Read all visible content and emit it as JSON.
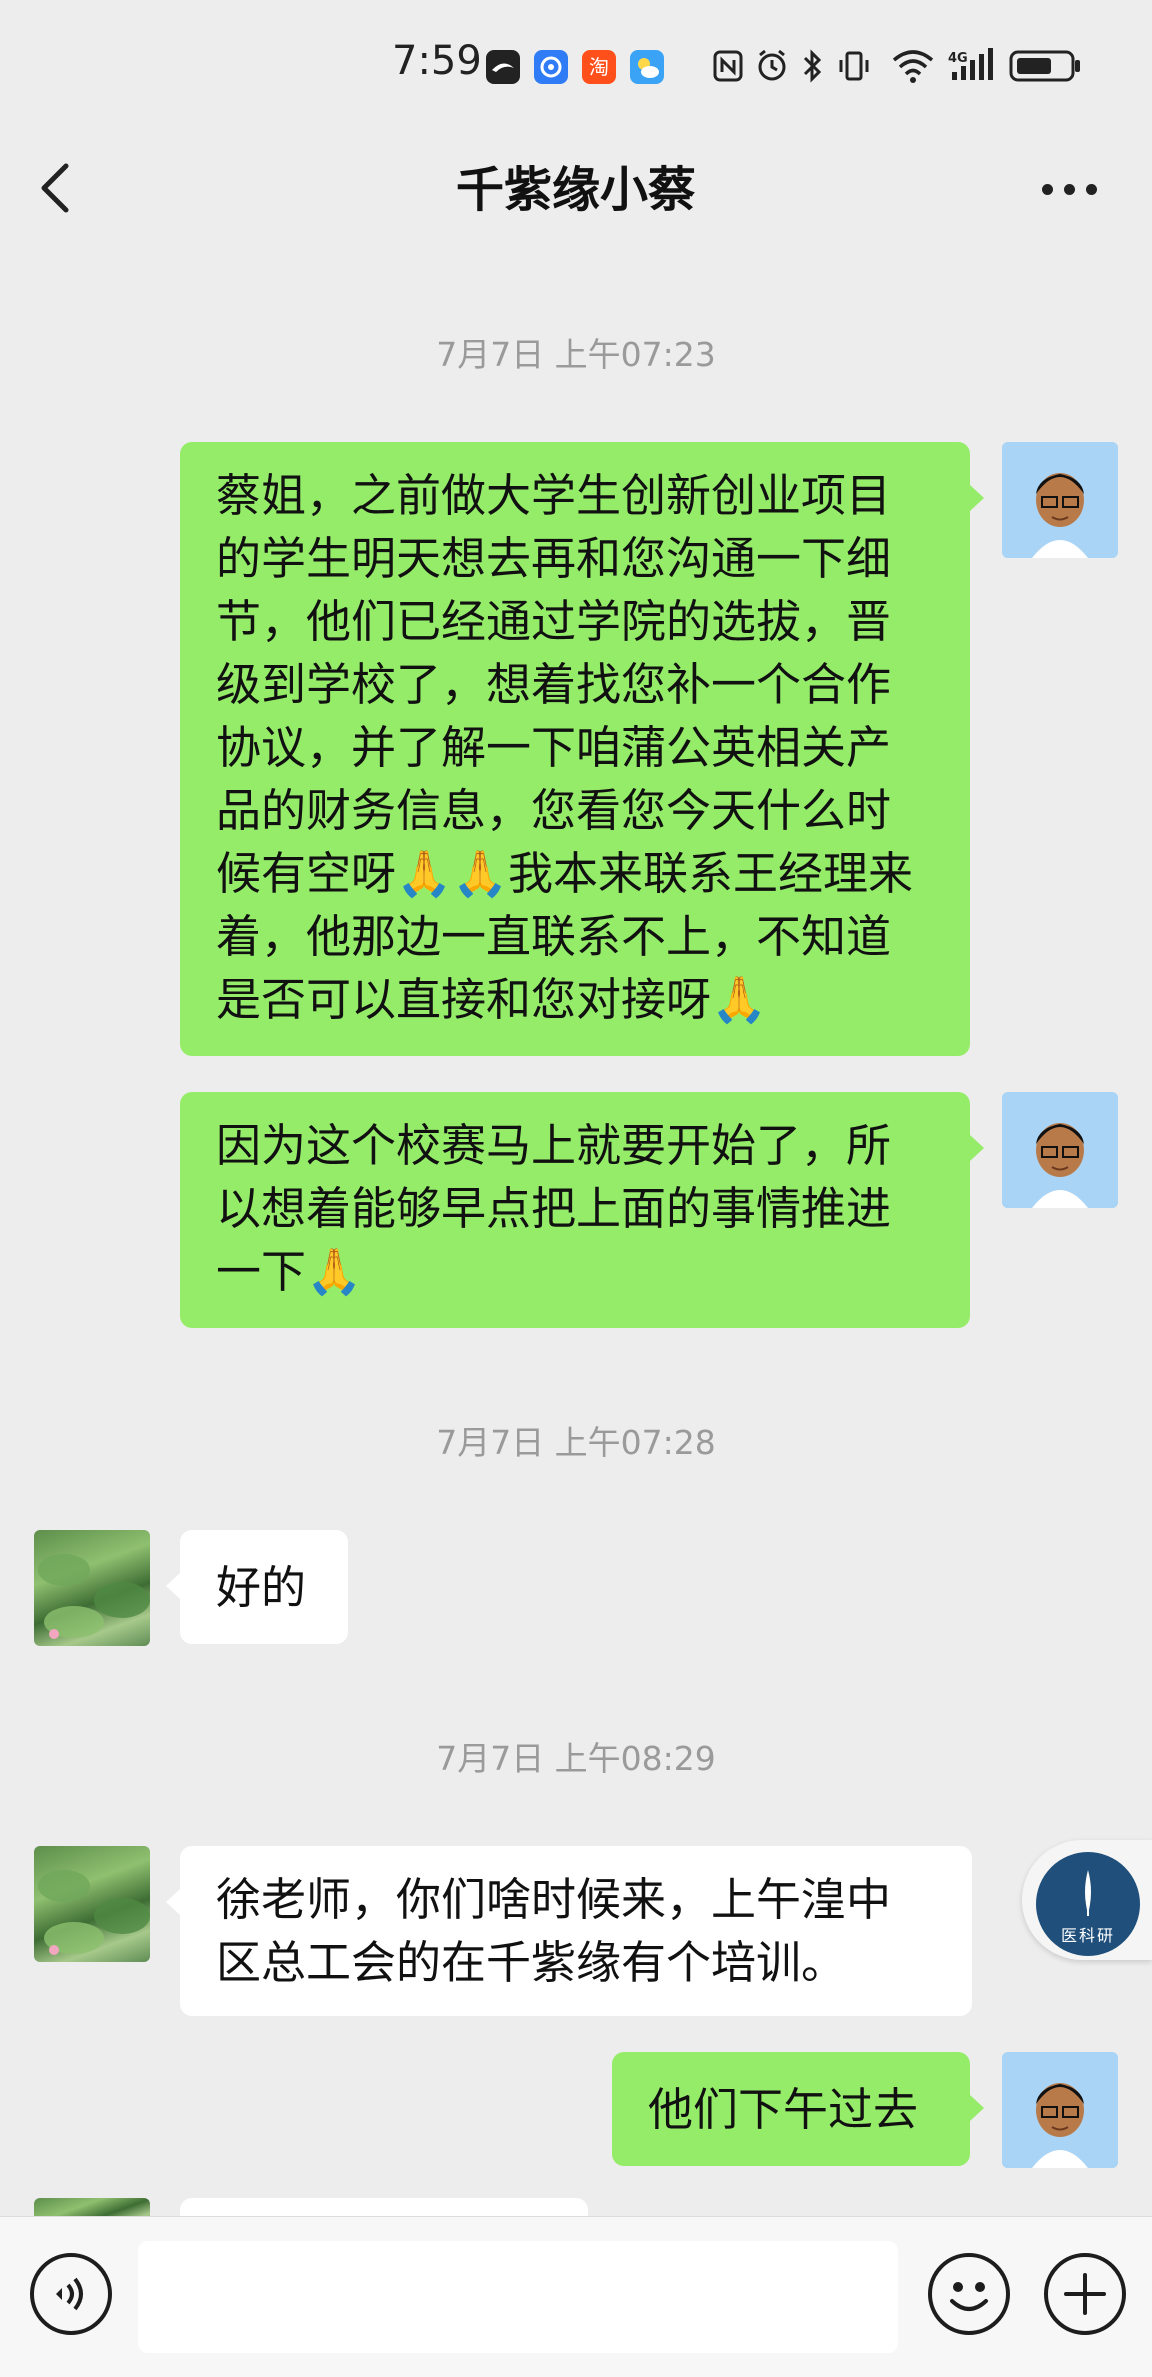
{
  "status_bar": {
    "time": "7:59",
    "app_icons": [
      "bird-app-icon",
      "browser-icon",
      "taobao-icon",
      "weather-icon"
    ],
    "right_icons": [
      "nfc-icon",
      "alarm-icon",
      "bluetooth-icon",
      "vibrate-icon",
      "wifi-icon",
      "signal-4g-icon",
      "battery-icon"
    ],
    "network": "4G"
  },
  "header": {
    "title": "千紫缘小蔡"
  },
  "messages": [
    {
      "type": "timestamp",
      "text": "7月7日 上午07:23"
    },
    {
      "type": "sent",
      "lines": [
        "蔡姐，之前做大学生创新创业项目",
        "的学生明天想去再和您沟通一下细",
        "节，他们已经通过学院的选拔，晋",
        "级到学校了，想着找您补一个合作",
        "协议，并了解一下咱蒲公英相关产",
        "品的财务信息，您看您今天什么时",
        "候有空呀🙏🙏我本来联系王经理来",
        "着，他那边一直联系不上，不知道",
        "是否可以直接和您对接呀🙏"
      ]
    },
    {
      "type": "sent",
      "lines": [
        "因为这个校赛马上就要开始了，所",
        "以想着能够早点把上面的事情推进",
        "一下🙏"
      ]
    },
    {
      "type": "timestamp",
      "text": "7月7日 上午07:28"
    },
    {
      "type": "received",
      "lines": [
        "好的"
      ]
    },
    {
      "type": "timestamp",
      "text": "7月7日 上午08:29"
    },
    {
      "type": "received",
      "lines": [
        "徐老师，你们啥时候来，上午湟中",
        "区总工会的在千紫缘有个培训。"
      ]
    },
    {
      "type": "sent",
      "lines": [
        "他们下午过去"
      ]
    }
  ],
  "floating_badge": {
    "label": "医科研"
  },
  "colors": {
    "sent_bubble": "#95ec69",
    "received_bubble": "#ffffff",
    "background": "#ededed"
  }
}
